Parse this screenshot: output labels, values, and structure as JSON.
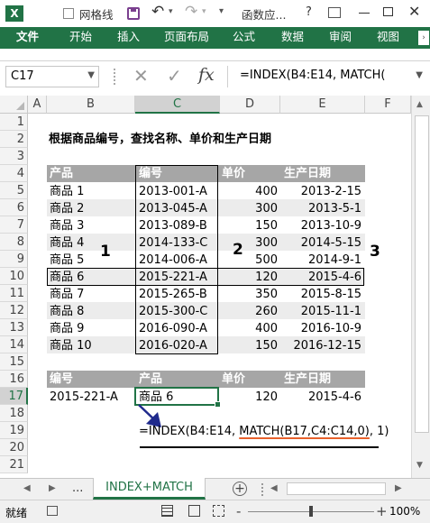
{
  "app": {
    "title": "函数应...",
    "help": "?",
    "file_badge": "X"
  },
  "qat": {
    "gridlines_label": "网格线"
  },
  "ribbon": {
    "tabs": [
      "文件",
      "开始",
      "插入",
      "页面布局",
      "公式",
      "数据",
      "审阅",
      "视图"
    ]
  },
  "formula_bar": {
    "name_box": "C17",
    "formula": "=INDEX(B4:E14, MATCH(",
    "fx": "fx"
  },
  "columns": [
    "A",
    "B",
    "C",
    "D",
    "E",
    "F"
  ],
  "rows": [
    "1",
    "2",
    "3",
    "4",
    "5",
    "6",
    "7",
    "8",
    "9",
    "10",
    "11",
    "12",
    "13",
    "14",
    "15",
    "16",
    "17",
    "18",
    "19",
    "20",
    "21"
  ],
  "sheet": {
    "title": "根据商品编号，查找名称、单价和生产日期",
    "table_headers": [
      "产品",
      "编号",
      "单价",
      "生产日期"
    ],
    "table_rows": [
      [
        "商品 1",
        "2013-001-A",
        "400",
        "2013-2-15"
      ],
      [
        "商品 2",
        "2013-045-A",
        "300",
        "2013-5-1"
      ],
      [
        "商品 3",
        "2013-089-B",
        "150",
        "2013-10-9"
      ],
      [
        "商品 4",
        "2014-133-C",
        "300",
        "2014-5-15"
      ],
      [
        "商品 5",
        "2014-006-A",
        "500",
        "2014-9-1"
      ],
      [
        "商品 6",
        "2015-221-A",
        "120",
        "2015-4-6"
      ],
      [
        "商品 7",
        "2015-265-B",
        "350",
        "2015-8-15"
      ],
      [
        "商品 8",
        "2015-300-C",
        "260",
        "2015-11-1"
      ],
      [
        "商品 9",
        "2016-090-A",
        "400",
        "2016-10-9"
      ],
      [
        "商品 10",
        "2016-020-A",
        "150",
        "2016-12-15"
      ]
    ],
    "markers": [
      "1",
      "2",
      "3"
    ],
    "lookup_headers": [
      "编号",
      "产品",
      "单价",
      "生产日期"
    ],
    "lookup_values": [
      "2015-221-A",
      "商品 6",
      "120",
      "2015-4-6"
    ],
    "formula_note_prefix": "=INDEX(B4:E14, ",
    "formula_note_match": "MATCH(B17,C4:C14,0)",
    "formula_note_suffix": ", 1)"
  },
  "sheet_tabs": {
    "ellipsis": "...",
    "active": "INDEX+MATCH",
    "add": "+"
  },
  "status": {
    "ready": "就绪",
    "zoom": "100%",
    "minus": "-",
    "plus": "+"
  },
  "colors": {
    "excel_green": "#217346",
    "header_gray": "#a6a6a6",
    "band_gray": "#ececec",
    "active_cell": "#217346",
    "arrow": "#1f2a8c",
    "underline": "#e8612c"
  }
}
